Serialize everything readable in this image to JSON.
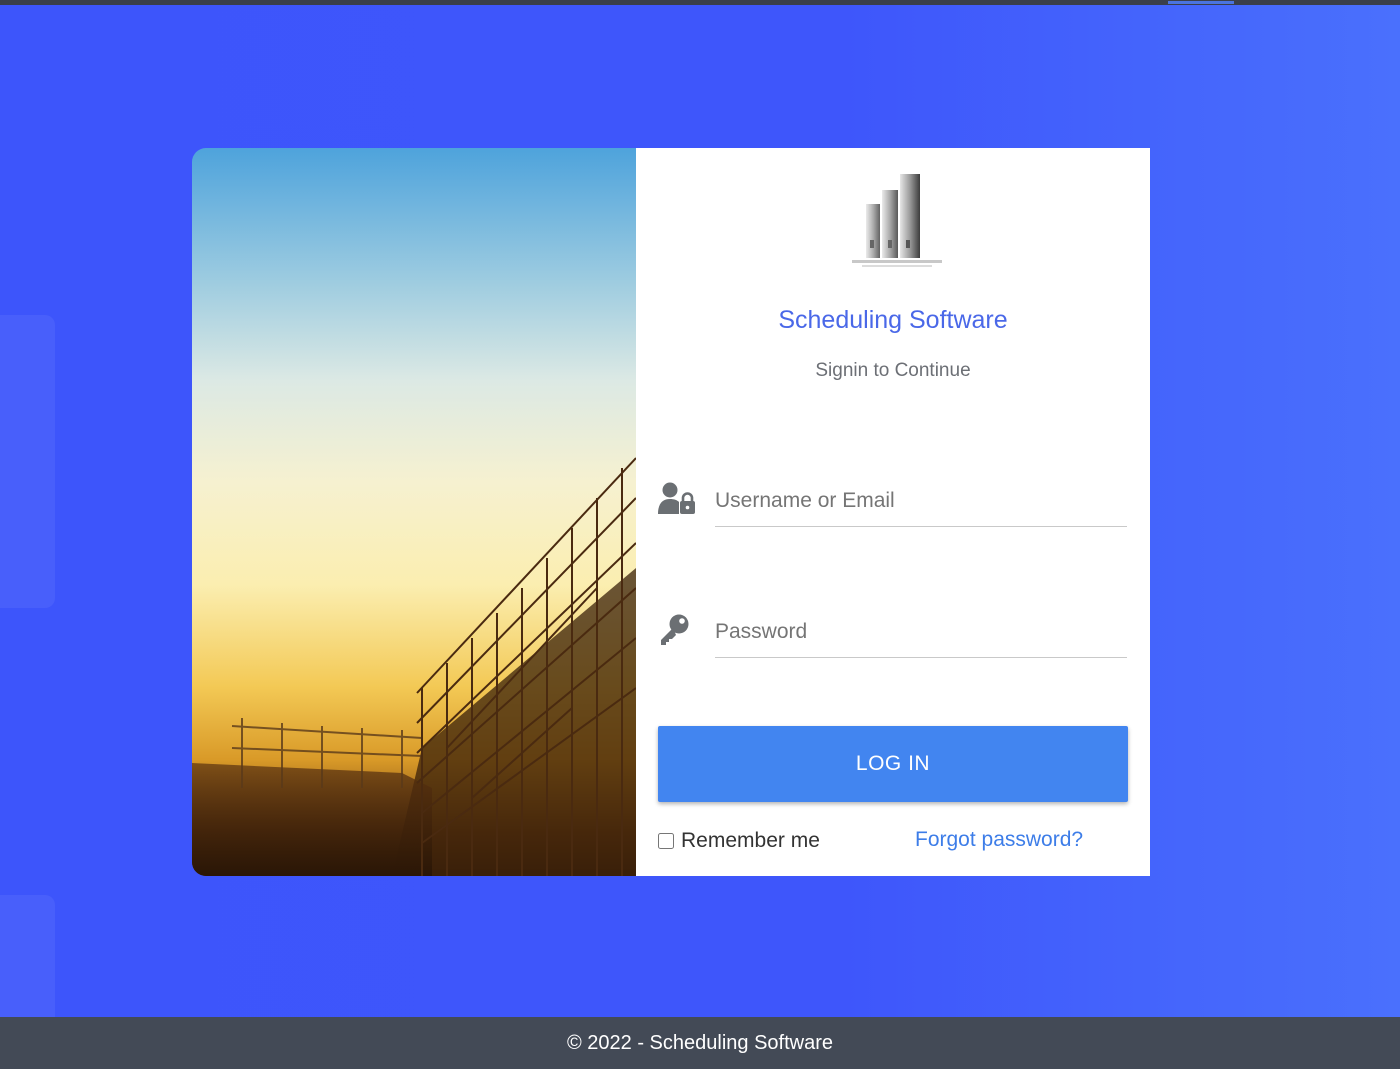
{
  "login": {
    "app_title": "Scheduling Software",
    "subtitle": "Signin to Continue",
    "username_placeholder": "Username or Email",
    "password_placeholder": "Password",
    "login_button": "LOG IN",
    "remember_label": "Remember me",
    "forgot_link": "Forgot password?"
  },
  "footer": {
    "text": "© 2022 - Scheduling Software"
  },
  "icons": {
    "user": "user-lock-icon",
    "password": "key-icon",
    "logo": "building-logo-icon"
  },
  "colors": {
    "background": "#3d55fb",
    "accent": "#4285f0",
    "title": "#4a68e8",
    "link": "#3d7de8",
    "footer": "#434a56"
  }
}
